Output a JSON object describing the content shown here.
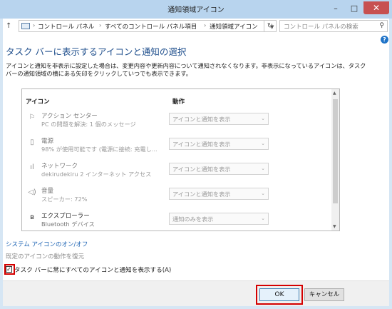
{
  "window": {
    "title": "通知領域アイコン",
    "min_glyph": "–",
    "max_glyph": "□",
    "close_glyph": "✕"
  },
  "address": {
    "crumbs": [
      "コントロール パネル",
      "すべてのコントロール パネル項目",
      "通知領域アイコン"
    ],
    "search_placeholder": "コントロール パネルの検索"
  },
  "content": {
    "heading": "タスク バーに表示するアイコンと通知の選択",
    "description": "アイコンと通知を非表示に設定した場合は、変更内容や更新内容について通知されなくなります。非表示になっているアイコンは、タスク バーの通知領域の横にある矢印をクリックしていつでも表示できます。",
    "col_icon": "アイコン",
    "col_action": "動作",
    "rows": [
      {
        "icon": "flag-icon",
        "name": "アクション センター",
        "sub": "PC の問題を解決: 1 個のメッセージ",
        "action": "アイコンと通知を表示"
      },
      {
        "icon": "battery-icon",
        "name": "電源",
        "sub": "98% が使用可能です (電源に接続: 充電し...",
        "action": "アイコンと通知を表示"
      },
      {
        "icon": "network-icon",
        "name": "ネットワーク",
        "sub": "dekirudekiru  2 インターネット アクセス",
        "action": "アイコンと通知を表示"
      },
      {
        "icon": "speaker-icon",
        "name": "音量",
        "sub": "スピーカー: 72%",
        "action": "アイコンと通知を表示"
      },
      {
        "icon": "bluetooth-icon",
        "name": "エクスプローラー",
        "sub": "Bluetooth デバイス",
        "action": "通知のみを表示"
      }
    ],
    "link_system_icons": "システム アイコンのオン/オフ",
    "link_restore": "既定のアイコンの動作を復元",
    "checkbox_label": "タスク バーに常にすべてのアイコンと通知を表示する(A)",
    "checkbox_checked": true
  },
  "footer": {
    "ok": "OK",
    "cancel": "キャンセル"
  },
  "colors": {
    "title_bar": "#b8d4ee",
    "heading": "#1e4e8c",
    "link": "#1e64b4",
    "highlight": "#d40000",
    "close": "#c75050"
  }
}
